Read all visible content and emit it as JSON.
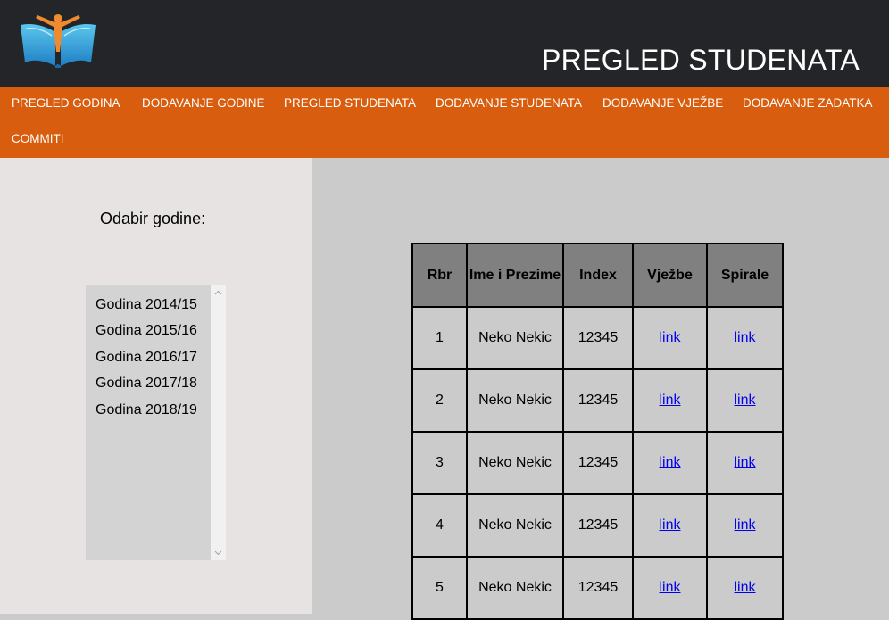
{
  "header": {
    "title": "PREGLED STUDENATA"
  },
  "nav": {
    "items": [
      "PREGLED GODINA",
      "DODAVANJE GODINE",
      "PREGLED STUDENATA",
      "DODAVANJE STUDENATA",
      "DODAVANJE VJEŽBE",
      "DODAVANJE ZADATKA",
      "COMMITI"
    ]
  },
  "sidebar": {
    "label": "Odabir godine:",
    "options": [
      "Godina 2014/15",
      "Godina 2015/16",
      "Godina 2016/17",
      "Godina 2017/18",
      "Godina 2018/19"
    ]
  },
  "table": {
    "headers": [
      "Rbr",
      "Ime i Prezime",
      "Index",
      "Vježbe",
      "Spirale"
    ],
    "rows": [
      {
        "rbr": "1",
        "name": "Neko Nekic",
        "index": "12345",
        "vjezbe": "link",
        "spirale": "link"
      },
      {
        "rbr": "2",
        "name": "Neko Nekic",
        "index": "12345",
        "vjezbe": "link",
        "spirale": "link"
      },
      {
        "rbr": "3",
        "name": "Neko Nekic",
        "index": "12345",
        "vjezbe": "link",
        "spirale": "link"
      },
      {
        "rbr": "4",
        "name": "Neko Nekic",
        "index": "12345",
        "vjezbe": "link",
        "spirale": "link"
      },
      {
        "rbr": "5",
        "name": "Neko Nekic",
        "index": "12345",
        "vjezbe": "link",
        "spirale": "link"
      }
    ]
  },
  "colors": {
    "header_bg": "#232528",
    "nav_bg": "#d95d0e",
    "sidebar_bg": "#e6e3e2",
    "content_bg": "#cbcbcb",
    "table_head_bg": "#808080",
    "link": "#0000ee"
  }
}
